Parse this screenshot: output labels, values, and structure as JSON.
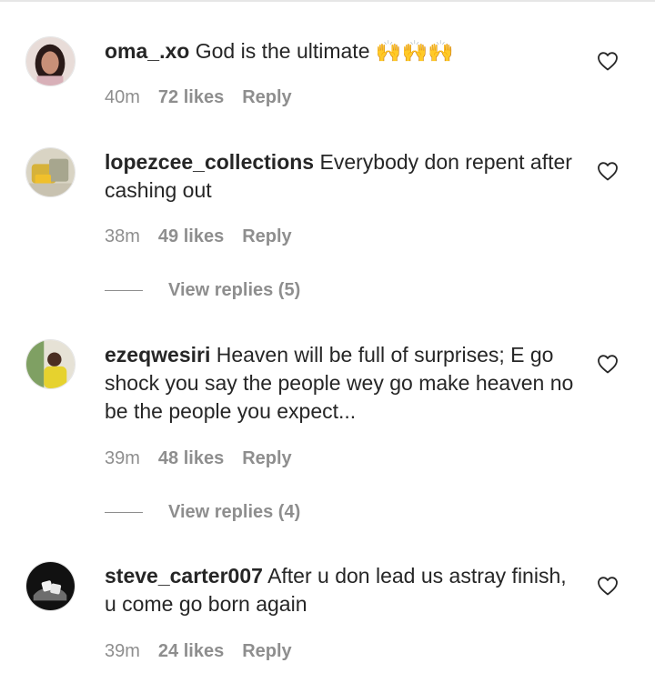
{
  "comments": [
    {
      "username": "oma_.xo",
      "text": "God is the ultimate",
      "emoji": "🙌🙌🙌",
      "time": "40m",
      "likes": "72 likes",
      "reply": "Reply"
    },
    {
      "username": "lopezcee_collections",
      "text": "Everybody don repent after cashing out",
      "time": "38m",
      "likes": "49 likes",
      "reply": "Reply",
      "view_replies": "View replies (5)"
    },
    {
      "username": "ezeqwesiri",
      "text": "Heaven will be full of surprises; E go shock you say the people wey go make heaven no be the people you expect...",
      "time": "39m",
      "likes": "48 likes",
      "reply": "Reply",
      "view_replies": "View replies (4)"
    },
    {
      "username": "steve_carter007",
      "text": "After u don lead us astray finish, u come go born again",
      "time": "39m",
      "likes": "24 likes",
      "reply": "Reply"
    }
  ],
  "icons": {
    "like": "heart-outline-icon"
  },
  "colors": {
    "text": "#262626",
    "muted": "#8e8e8e",
    "emoji": "#f5b820"
  }
}
